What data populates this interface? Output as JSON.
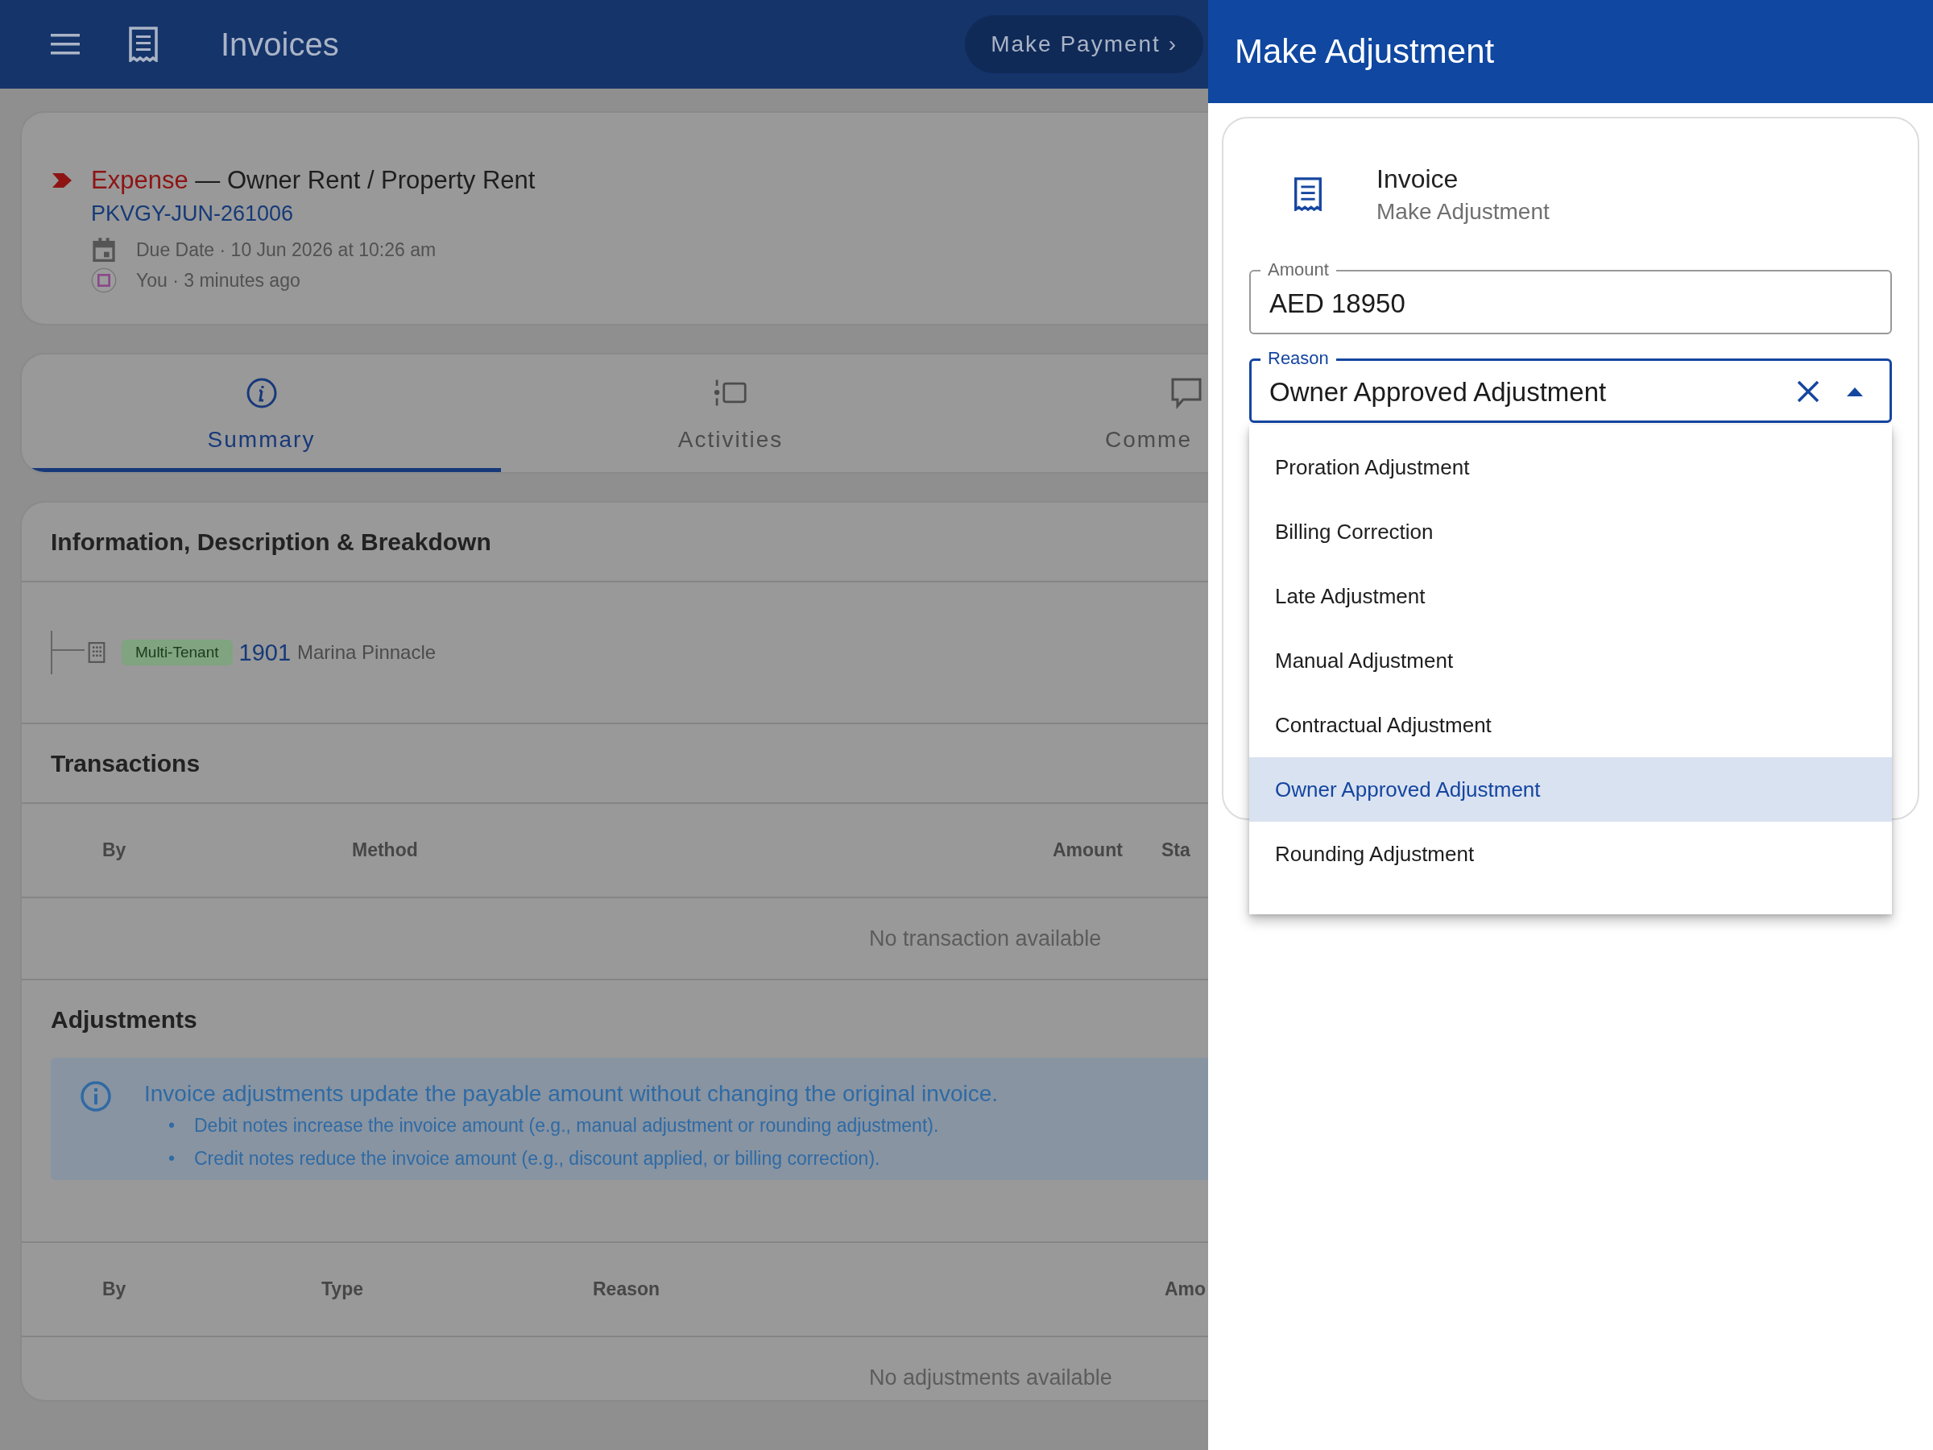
{
  "app_bar": {
    "title": "Invoices",
    "action": "Make Payment ›"
  },
  "invoice": {
    "category": "Expense",
    "title": "— Owner Rent / Property Rent",
    "reference": "PKVGY-JUN-261006",
    "due": "Due Date · 10 Jun 2026 at 10:26 am",
    "created": "You · 3 minutes ago"
  },
  "tabs": [
    {
      "label": "Summary",
      "selected": true
    },
    {
      "label": "Activities",
      "selected": false
    },
    {
      "label": "Comme",
      "selected": false
    }
  ],
  "breakdown": {
    "title": "Information, Description & Breakdown",
    "unit": {
      "tag": "Multi-Tenant",
      "number": "1901",
      "name": "Marina Pinnacle"
    }
  },
  "transactions": {
    "title": "Transactions",
    "columns": [
      "By",
      "Method",
      "Amount",
      "Sta"
    ],
    "empty": "No transaction available"
  },
  "adjustments": {
    "title": "Adjustments",
    "info": {
      "bullet": "•",
      "heading": "Invoice adjustments update the payable amount without changing the original invoice.",
      "bullets": [
        "Debit notes increase the invoice amount (e.g., manual adjustment or rounding adjustment).",
        "Credit notes reduce the invoice amount (e.g., discount applied, or billing correction)."
      ]
    },
    "columns": [
      "By",
      "Type",
      "Reason",
      "Amo"
    ],
    "empty": "No adjustments available"
  },
  "panel": {
    "title": "Make Adjustment",
    "subject": "Invoice",
    "subtitle": "Make Adjustment",
    "amount": {
      "label": "Amount",
      "value": "AED 18950"
    },
    "reason": {
      "label": "Reason",
      "value": "Owner Approved Adjustment",
      "expanded": true,
      "options": [
        {
          "label": "Proration Adjustment",
          "selected": false
        },
        {
          "label": "Billing Correction",
          "selected": false
        },
        {
          "label": "Late Adjustment",
          "selected": false
        },
        {
          "label": "Manual Adjustment",
          "selected": false
        },
        {
          "label": "Contractual Adjustment",
          "selected": false
        },
        {
          "label": "Owner Approved Adjustment",
          "selected": true
        },
        {
          "label": "Rounding Adjustment",
          "selected": false
        }
      ]
    }
  }
}
